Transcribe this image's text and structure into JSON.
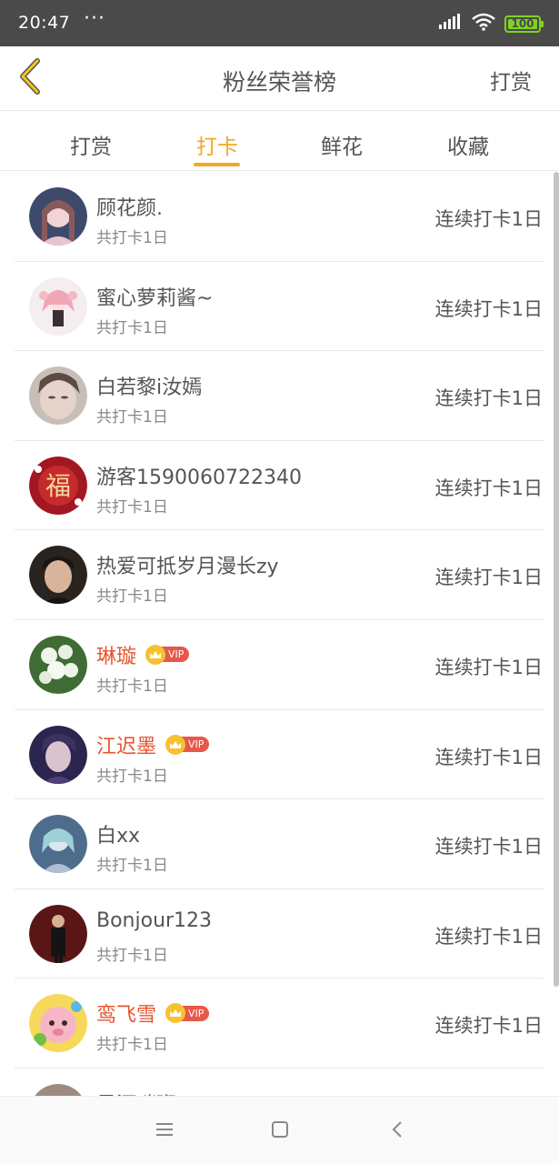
{
  "status_bar": {
    "time": "20:47",
    "dots": "···",
    "battery": "100",
    "icons": [
      "signal-icon",
      "wifi-icon",
      "battery-icon"
    ]
  },
  "header": {
    "title": "粉丝荣誉榜",
    "right_action": "打赏",
    "back_icon": "chevron-left-icon"
  },
  "tabs": [
    {
      "label": "打赏",
      "active": false
    },
    {
      "label": "打卡",
      "active": true
    },
    {
      "label": "鲜花",
      "active": false
    },
    {
      "label": "收藏",
      "active": false
    }
  ],
  "colors": {
    "accent": "#f5a623",
    "vip_name": "#e8542f",
    "vip_tag": "#e8584a",
    "crown": "#f7c22f"
  },
  "fans": [
    {
      "name": "顾花颜.",
      "vip": false,
      "sub": "共打卡1日",
      "streak": "连续打卡1日"
    },
    {
      "name": "蜜心萝莉酱~",
      "vip": false,
      "sub": "共打卡1日",
      "streak": "连续打卡1日"
    },
    {
      "name": "白若黎i汝嫣",
      "vip": false,
      "sub": "共打卡1日",
      "streak": "连续打卡1日"
    },
    {
      "name": "游客1590060722340",
      "vip": false,
      "sub": "共打卡1日",
      "streak": "连续打卡1日"
    },
    {
      "name": "热爱可抵岁月漫长zy",
      "vip": false,
      "sub": "共打卡1日",
      "streak": "连续打卡1日"
    },
    {
      "name": "琳璇",
      "vip": true,
      "vip_label": "VIP",
      "sub": "共打卡1日",
      "streak": "连续打卡1日"
    },
    {
      "name": "江迟墨",
      "vip": true,
      "vip_label": "VIP",
      "sub": "共打卡1日",
      "streak": "连续打卡1日"
    },
    {
      "name": "白xx",
      "vip": false,
      "sub": "共打卡1日",
      "streak": "连续打卡1日"
    },
    {
      "name": "Bonjour123",
      "vip": false,
      "sub": "共打卡1日",
      "streak": "连续打卡1日"
    },
    {
      "name": "鸾飞雪",
      "vip": true,
      "vip_label": "VIP",
      "sub": "共打卡1日",
      "streak": "连续打卡1日"
    },
    {
      "name": "星河璀璨",
      "vip": false,
      "sub": "",
      "streak": ""
    }
  ],
  "nav": {
    "icons": [
      "menu-icon",
      "home-icon",
      "back-icon"
    ]
  }
}
